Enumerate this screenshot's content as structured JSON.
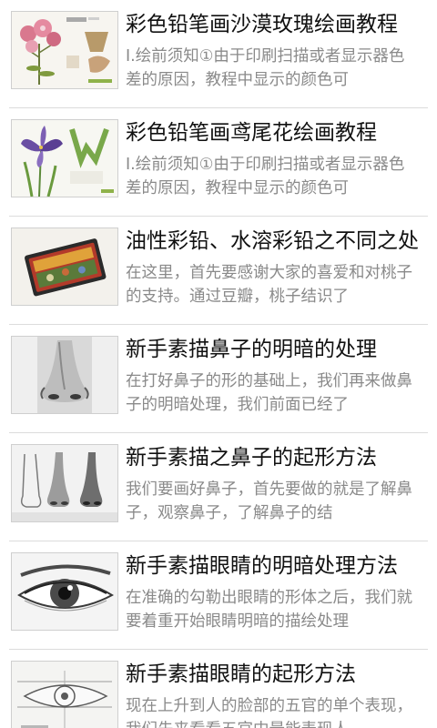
{
  "articles": [
    {
      "title": "彩色铅笔画沙漠玫瑰绘画教程",
      "summary": "Ⅰ.绘前须知①由于印刷扫描或者显示器色差的原因，教程中显示的颜色可",
      "thumb_icon": "pink-flower-illustration"
    },
    {
      "title": "彩色铅笔画鸢尾花绘画教程",
      "summary": "Ⅰ.绘前须知①由于印刷扫描或者显示器色差的原因，教程中显示的颜色可",
      "thumb_icon": "iris-flower-illustration"
    },
    {
      "title": "油性彩铅、水溶彩铅之不同之处",
      "summary": "在这里，首先要感谢大家的喜爱和对桃子的支持。通过豆瓣，桃子结识了",
      "thumb_icon": "colored-pencil-tin"
    },
    {
      "title": "新手素描鼻子的明暗的处理",
      "summary": "在打好鼻子的形的基础上，我们再来做鼻子的明暗处理，我们前面已经了",
      "thumb_icon": "nose-sketch"
    },
    {
      "title": "新手素描之鼻子的起形方法",
      "summary": "我们要画好鼻子，首先要做的就是了解鼻子，观察鼻子，了解鼻子的结",
      "thumb_icon": "nose-steps-sketch"
    },
    {
      "title": "新手素描眼睛的明暗处理方法",
      "summary": "在准确的勾勒出眼睛的形体之后，我们就要着重开始眼睛明暗的描绘处理",
      "thumb_icon": "eye-sketch"
    },
    {
      "title": "新手素描眼睛的起形方法",
      "summary": "现在上升到人的脸部的五官的单个表现，我们先来看看五官中最能表现人",
      "thumb_icon": "eye-diagram-sketch"
    }
  ]
}
